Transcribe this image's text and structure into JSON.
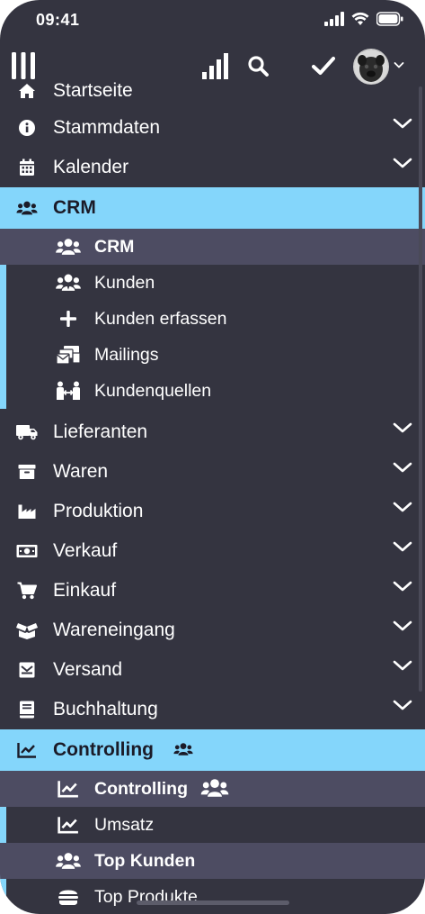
{
  "status_bar": {
    "time": "09:41"
  },
  "top_bar": {
    "icons": [
      "hamburger-icon",
      "chart-bars-icon",
      "search-icon",
      "check-icon",
      "avatar",
      "chevron-down-icon"
    ]
  },
  "menu": {
    "items": [
      {
        "label": "Startseite",
        "icon": "home-icon"
      },
      {
        "label": "Stammdaten",
        "icon": "info-icon",
        "expandable": true
      },
      {
        "label": "Kalender",
        "icon": "calendar-icon",
        "expandable": true
      },
      {
        "label": "CRM",
        "icon": "users-icon",
        "active": true,
        "children": [
          {
            "label": "CRM",
            "icon": "users-icon",
            "highlighted": true
          },
          {
            "label": "Kunden",
            "icon": "users-tie-icon"
          },
          {
            "label": "Kunden erfassen",
            "icon": "plus-icon"
          },
          {
            "label": "Mailings",
            "icon": "mail-bulk-icon"
          },
          {
            "label": "Kundenquellen",
            "icon": "people-arrows-icon"
          }
        ]
      },
      {
        "label": "Lieferanten",
        "icon": "truck-icon",
        "expandable": true
      },
      {
        "label": "Waren",
        "icon": "archive-icon",
        "expandable": true
      },
      {
        "label": "Produktion",
        "icon": "industry-icon",
        "expandable": true
      },
      {
        "label": "Verkauf",
        "icon": "money-icon",
        "expandable": true
      },
      {
        "label": "Einkauf",
        "icon": "cart-icon",
        "expandable": true
      },
      {
        "label": "Wareneingang",
        "icon": "box-open-icon",
        "expandable": true
      },
      {
        "label": "Versand",
        "icon": "envelope-icon",
        "expandable": true
      },
      {
        "label": "Buchhaltung",
        "icon": "book-icon",
        "expandable": true
      },
      {
        "label": "Controlling",
        "icon": "chart-line-icon",
        "active": true,
        "badge_icon": "users-icon",
        "children": [
          {
            "label": "Controlling",
            "icon": "chart-line-icon",
            "highlighted": true,
            "badge_icon": "users-icon"
          },
          {
            "label": "Umsatz",
            "icon": "chart-line-icon"
          },
          {
            "label": "Top Kunden",
            "icon": "users-icon",
            "highlighted": true
          },
          {
            "label": "Top Produkte",
            "icon": "burger-icon"
          }
        ]
      }
    ]
  },
  "colors": {
    "background": "#343440",
    "active": "#84d6fb",
    "highlight": "#4d4c62",
    "text": "#ffffff",
    "active_text": "#1b1b28"
  }
}
